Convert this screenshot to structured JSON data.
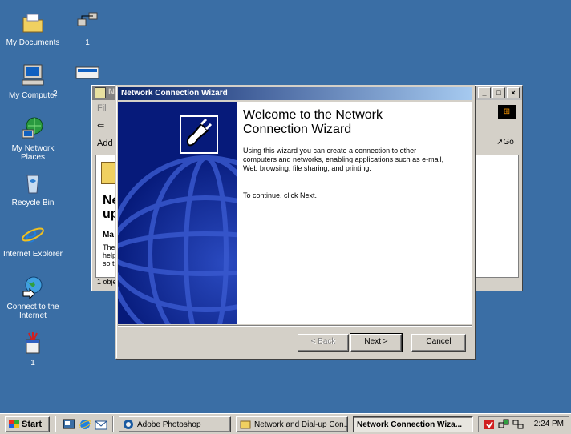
{
  "desktop": {
    "icons": [
      {
        "label": "My Documents"
      },
      {
        "label": "My Computer"
      },
      {
        "label": "My Network Places"
      },
      {
        "label": "Recycle Bin"
      },
      {
        "label": "Internet Explorer"
      },
      {
        "label": "Connect to the Internet"
      },
      {
        "label": "1"
      }
    ],
    "shortcuts": [
      {
        "label": "1"
      },
      {
        "label": "2"
      }
    ]
  },
  "back_window": {
    "title": "Ne",
    "menu_fragment": "Fil",
    "address_label": "Add",
    "go_label": "Go",
    "heading_fragment": "Network up",
    "section_fragment": "Ma",
    "para_fragment": "The help so t",
    "status_fragment": "1 obje"
  },
  "wizard": {
    "title": "Network Connection Wizard",
    "heading": "Welcome to the Network Connection Wizard",
    "intro": "Using this wizard you can create a connection to other computers and networks, enabling applications such as e-mail, Web browsing, file sharing, and printing.",
    "continue_text": "To continue, click Next.",
    "buttons": {
      "back": "< Back",
      "next": "Next >",
      "cancel": "Cancel"
    }
  },
  "taskbar": {
    "start_label": "Start",
    "tasks": [
      {
        "label": "Adobe Photoshop",
        "active": false
      },
      {
        "label": "Network and Dial-up Con...",
        "active": false
      },
      {
        "label": "Network Connection Wiza...",
        "active": true
      }
    ],
    "clock": "2:24 PM"
  },
  "colors": {
    "desktop": "#3a6ea5",
    "titlebar_active": "#0a246a",
    "wizard_sidebar": "#061a7a",
    "window": "#d4d0c8"
  }
}
